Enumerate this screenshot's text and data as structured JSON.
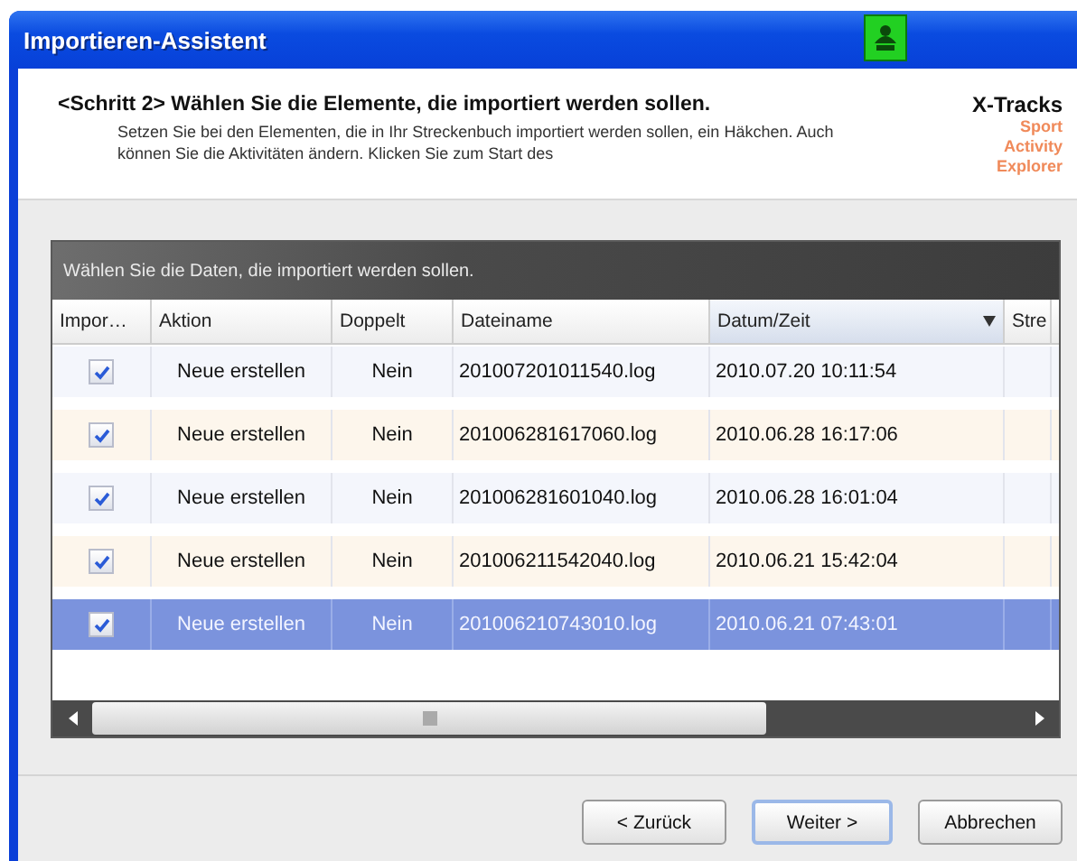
{
  "window": {
    "title": "Importieren-Assistent"
  },
  "header": {
    "step": "<Schritt 2>",
    "heading": "Wählen Sie die Elemente, die importiert werden sollen.",
    "description": "Setzen Sie bei den Elementen, die in Ihr Streckenbuch importiert werden sollen, ein Häkchen. Auch können Sie die Aktivitäten ändern. Klicken Sie zum Start des",
    "brand": "X-Tracks",
    "brand_lines": [
      "Sport",
      "Activity",
      "Explorer"
    ]
  },
  "table": {
    "caption": "Wählen Sie die Daten, die importiert werden sollen.",
    "columns": [
      {
        "label": "Impor…",
        "sorted": false
      },
      {
        "label": "Aktion",
        "sorted": false
      },
      {
        "label": "Doppelt",
        "sorted": false
      },
      {
        "label": "Dateiname",
        "sorted": false
      },
      {
        "label": "Datum/Zeit",
        "sorted": true
      },
      {
        "label": "Stre",
        "sorted": false
      }
    ],
    "rows": [
      {
        "checked": true,
        "selected": false,
        "cells": [
          "",
          "Neue erstellen",
          "Nein",
          "201007201011540.log",
          "2010.07.20 10:11:54"
        ]
      },
      {
        "checked": true,
        "selected": false,
        "cells": [
          "",
          "Neue erstellen",
          "Nein",
          "201006281617060.log",
          "2010.06.28 16:17:06"
        ]
      },
      {
        "checked": true,
        "selected": false,
        "cells": [
          "",
          "Neue erstellen",
          "Nein",
          "201006281601040.log",
          "2010.06.28 16:01:04"
        ]
      },
      {
        "checked": true,
        "selected": false,
        "cells": [
          "",
          "Neue erstellen",
          "Nein",
          "201006211542040.log",
          "2010.06.21 15:42:04"
        ]
      },
      {
        "checked": true,
        "selected": true,
        "cells": [
          "",
          "Neue erstellen",
          "Nein",
          "201006210743010.log",
          "2010.06.21 07:43:01"
        ]
      }
    ]
  },
  "buttons": [
    {
      "label": "< Zurück",
      "default": false
    },
    {
      "label": "Weiter >",
      "default": true
    },
    {
      "label": "Abbrechen",
      "default": false
    }
  ]
}
